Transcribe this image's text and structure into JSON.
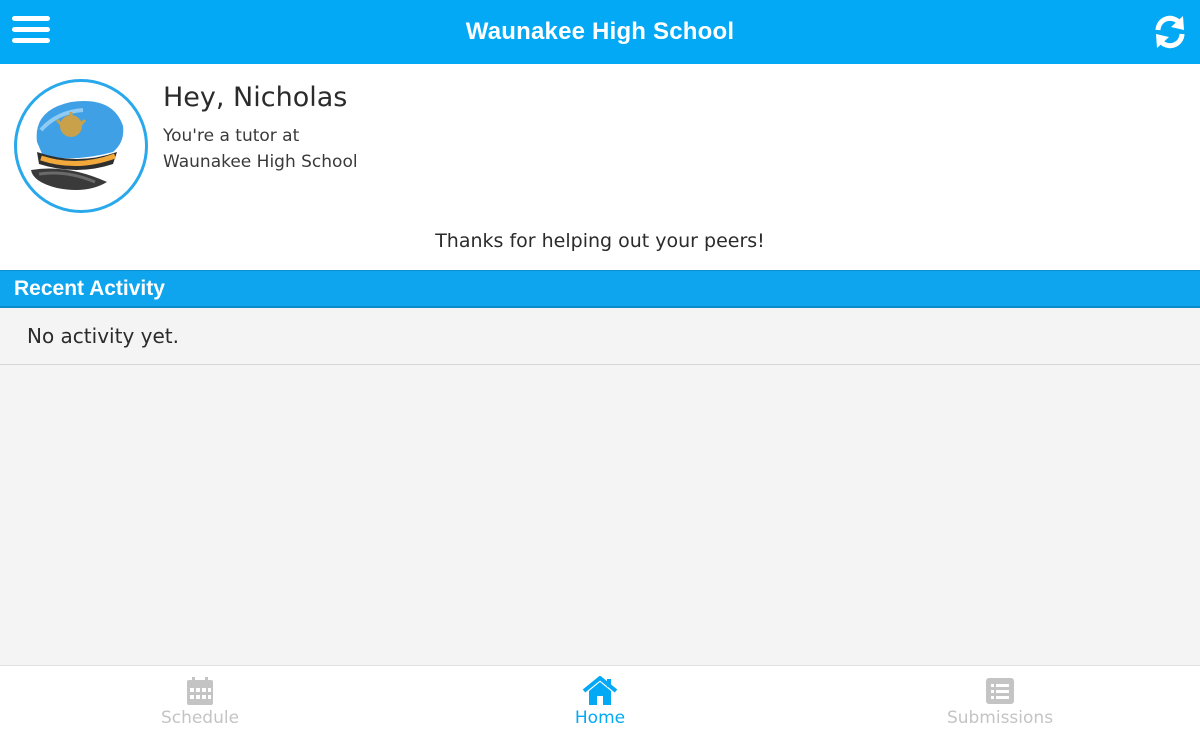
{
  "header": {
    "title": "Waunakee High School",
    "menu_icon": "hamburger-menu-icon",
    "refresh_icon": "refresh-icon",
    "color": "#03a9f4"
  },
  "profile": {
    "greeting": "Hey, Nicholas",
    "role_line": "You're a tutor at",
    "school_line": "Waunakee High School",
    "avatar_icon": "officer-cap-avatar",
    "thanks": "Thanks for helping out your peers!"
  },
  "recent_activity": {
    "title": "Recent Activity",
    "empty_text": "No activity yet."
  },
  "bottom_nav": {
    "items": [
      {
        "label": "Schedule",
        "icon": "calendar-icon",
        "active": false
      },
      {
        "label": "Home",
        "icon": "home-icon",
        "active": true
      },
      {
        "label": "Submissions",
        "icon": "list-icon",
        "active": false
      }
    ],
    "active_color": "#03a9f4",
    "inactive_color": "#c4c4c4"
  }
}
